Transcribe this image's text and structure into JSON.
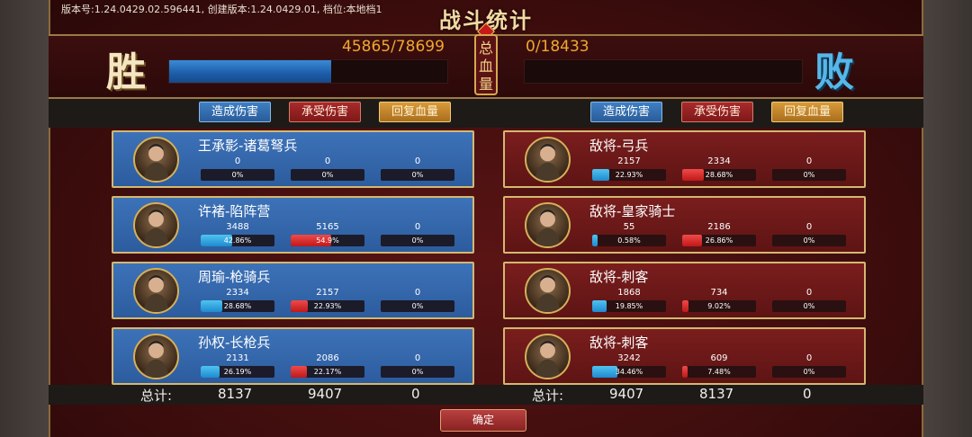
{
  "build_info": "版本号:1.24.0429.02.596441, 创建版本:1.24.0429.01, 档位:本地档1",
  "title": "战斗统计",
  "hp": {
    "win_label": "胜",
    "lose_label": "败",
    "center_label": [
      "总",
      "血",
      "量"
    ],
    "left_text": "45865/78699",
    "left_fraction": 0.5828,
    "right_text": "0/18433",
    "right_fraction": 0.0
  },
  "tabs": {
    "left": [
      "造成伤害",
      "承受伤害",
      "回复血量"
    ],
    "right": [
      "造成伤害",
      "承受伤害",
      "回复血量"
    ]
  },
  "left_units": [
    {
      "name": "王承影-诸葛弩兵",
      "portrait": "portrait-icon",
      "stats": [
        {
          "value": "0",
          "pct": "0%",
          "fraction": 0
        },
        {
          "value": "0",
          "pct": "0%",
          "fraction": 0
        },
        {
          "value": "0",
          "pct": "0%",
          "fraction": 0
        }
      ]
    },
    {
      "name": "许褚-陷阵营",
      "portrait": "portrait-icon",
      "stats": [
        {
          "value": "3488",
          "pct": "42.86%",
          "fraction": 0.4286
        },
        {
          "value": "5165",
          "pct": "54.9%",
          "fraction": 0.549
        },
        {
          "value": "0",
          "pct": "0%",
          "fraction": 0
        }
      ]
    },
    {
      "name": "周瑜-枪骑兵",
      "portrait": "portrait-icon",
      "stats": [
        {
          "value": "2334",
          "pct": "28.68%",
          "fraction": 0.2868
        },
        {
          "value": "2157",
          "pct": "22.93%",
          "fraction": 0.2293
        },
        {
          "value": "0",
          "pct": "0%",
          "fraction": 0
        }
      ]
    },
    {
      "name": "孙权-长枪兵",
      "portrait": "portrait-icon",
      "stats": [
        {
          "value": "2131",
          "pct": "26.19%",
          "fraction": 0.2619
        },
        {
          "value": "2086",
          "pct": "22.17%",
          "fraction": 0.2217
        },
        {
          "value": "0",
          "pct": "0%",
          "fraction": 0
        }
      ]
    }
  ],
  "right_units": [
    {
      "name": "敌将-弓兵",
      "portrait": "portrait-icon",
      "stats": [
        {
          "value": "2157",
          "pct": "22.93%",
          "fraction": 0.2293
        },
        {
          "value": "2334",
          "pct": "28.68%",
          "fraction": 0.2868
        },
        {
          "value": "0",
          "pct": "0%",
          "fraction": 0
        }
      ]
    },
    {
      "name": "敌将-皇家骑士",
      "portrait": "portrait-icon",
      "stats": [
        {
          "value": "55",
          "pct": "0.58%",
          "fraction": 0.0058
        },
        {
          "value": "2186",
          "pct": "26.86%",
          "fraction": 0.2686
        },
        {
          "value": "0",
          "pct": "0%",
          "fraction": 0
        }
      ]
    },
    {
      "name": "敌将-刺客",
      "portrait": "portrait-icon",
      "stats": [
        {
          "value": "1868",
          "pct": "19.85%",
          "fraction": 0.1985
        },
        {
          "value": "734",
          "pct": "9.02%",
          "fraction": 0.0902
        },
        {
          "value": "0",
          "pct": "0%",
          "fraction": 0
        }
      ]
    },
    {
      "name": "敌将-刺客",
      "portrait": "portrait-icon",
      "stats": [
        {
          "value": "3242",
          "pct": "34.46%",
          "fraction": 0.3446
        },
        {
          "value": "609",
          "pct": "7.48%",
          "fraction": 0.0748
        },
        {
          "value": "0",
          "pct": "0%",
          "fraction": 0
        }
      ]
    }
  ],
  "totals": {
    "label": "总计:",
    "left": [
      "8137",
      "9407",
      "0"
    ],
    "right": [
      "9407",
      "8137",
      "0"
    ]
  },
  "confirm_label": "确定",
  "colors": {
    "frame_red": "#5a1414",
    "ally_card_blue": "#2c5c9e",
    "enemy_card_red": "#6b1818",
    "bar_blue": "#1e8ad0",
    "bar_red": "#c01818",
    "hp_text": "#f0a830"
  }
}
